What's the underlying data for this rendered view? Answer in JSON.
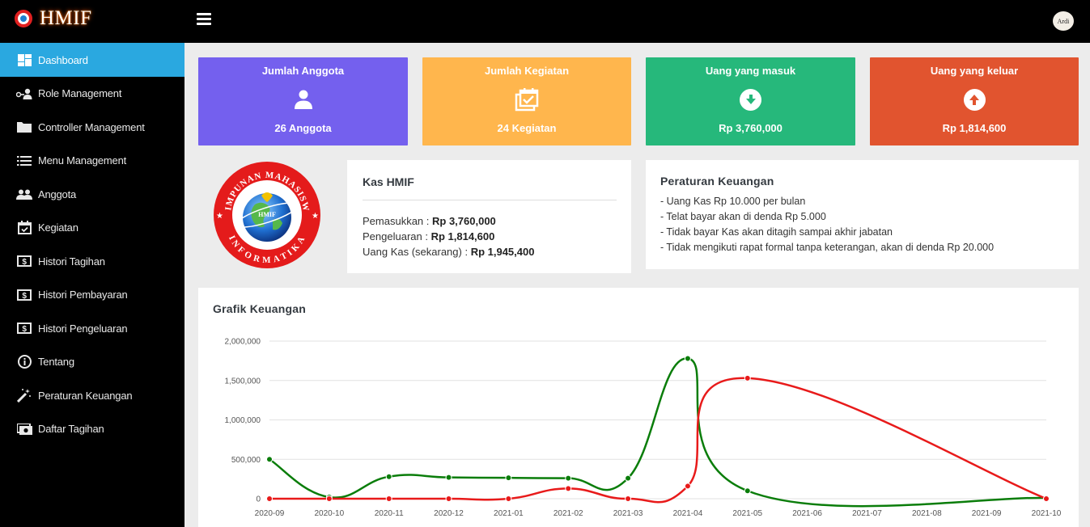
{
  "app": {
    "brand": "HMIF",
    "avatar_text": "Ardi"
  },
  "sidebar": {
    "items": [
      {
        "label": "Dashboard",
        "icon": "dashboard-icon",
        "active": true
      },
      {
        "label": "Role Management",
        "icon": "user-key-icon"
      },
      {
        "label": "Controller Management",
        "icon": "folder-icon"
      },
      {
        "label": "Menu Management",
        "icon": "list-icon"
      },
      {
        "label": "Anggota",
        "icon": "users-icon"
      },
      {
        "label": "Kegiatan",
        "icon": "calendar-check-icon"
      },
      {
        "label": "Histori Tagihan",
        "icon": "money-bill-icon"
      },
      {
        "label": "Histori Pembayaran",
        "icon": "money-bill-icon"
      },
      {
        "label": "Histori Pengeluaran",
        "icon": "money-bill-icon"
      },
      {
        "label": "Tentang",
        "icon": "info-circle-icon"
      },
      {
        "label": "Peraturan Keuangan",
        "icon": "magic-wand-icon"
      },
      {
        "label": "Daftar Tagihan",
        "icon": "money-bill-wave-icon"
      }
    ]
  },
  "stats": [
    {
      "title": "Jumlah Anggota",
      "value": "26 Anggota",
      "icon": "user-icon",
      "color": "#7460ee"
    },
    {
      "title": "Jumlah Kegiatan",
      "value": "24 Kegiatan",
      "icon": "calendar-check-icon",
      "color": "#ffb64d"
    },
    {
      "title": "Uang yang masuk",
      "value": "Rp 3,760,000",
      "icon": "arrow-circle-down-icon",
      "color": "#26b87b"
    },
    {
      "title": "Uang yang keluar",
      "value": "Rp 1,814,600",
      "icon": "arrow-circle-up-icon",
      "color": "#e1542f"
    }
  ],
  "logo": {
    "top_text": "HIMPUNAN MAHASISWA",
    "bottom_text": "INFORMATIKA",
    "center_text": "HMIF"
  },
  "kas": {
    "title": "Kas HMIF",
    "pemasukkan_label": "Pemasukkan : ",
    "pemasukkan_value": "Rp 3,760,000",
    "pengeluaran_label": "Pengeluaran : ",
    "pengeluaran_value": "Rp 1,814,600",
    "uangkas_label": "Uang Kas (sekarang) : ",
    "uangkas_value": "Rp 1,945,400"
  },
  "rules": {
    "title": "Peraturan Keuangan",
    "items": [
      "- Uang Kas Rp 10.000 per bulan",
      "- Telat bayar akan di denda Rp 5.000",
      "- Tidak bayar Kas akan ditagih sampai akhir jabatan",
      "- Tidak mengikuti rapat formal tanpa keterangan, akan di denda Rp 20.000"
    ]
  },
  "chart_data": {
    "type": "line",
    "title": "Grafik Keuangan",
    "x": [
      "2020-09",
      "2020-10",
      "2020-11",
      "2020-12",
      "2021-01",
      "2021-02",
      "2021-03",
      "2021-04",
      "2021-05",
      "2021-06",
      "2021-07",
      "2021-08",
      "2021-09",
      "2021-10"
    ],
    "ylim": [
      0,
      2000000
    ],
    "yticks": [
      0,
      500000,
      1000000,
      1500000,
      2000000
    ],
    "ytick_labels": [
      "0",
      "500,000",
      "1,000,000",
      "1,500,000",
      "2,000,000"
    ],
    "grid": true,
    "series": [
      {
        "color": "#0a7d0a",
        "points": [
          [
            "2020-09",
            500000
          ],
          [
            "2020-10",
            20000
          ],
          [
            "2020-11",
            280000
          ],
          [
            "2020-12",
            270000
          ],
          [
            "2021-01",
            265000
          ],
          [
            "2021-02",
            260000
          ],
          [
            "2021-03",
            260000
          ],
          [
            "2021-04",
            1780000
          ],
          [
            "2021-05",
            100000
          ],
          [
            "2021-10",
            10000
          ]
        ]
      },
      {
        "color": "#e81a1a",
        "points": [
          [
            "2020-09",
            0
          ],
          [
            "2020-10",
            0
          ],
          [
            "2020-11",
            0
          ],
          [
            "2020-12",
            0
          ],
          [
            "2021-01",
            0
          ],
          [
            "2021-02",
            130000
          ],
          [
            "2021-03",
            0
          ],
          [
            "2021-04",
            160000
          ],
          [
            "2021-05",
            1530000
          ],
          [
            "2021-10",
            0
          ]
        ]
      }
    ]
  }
}
